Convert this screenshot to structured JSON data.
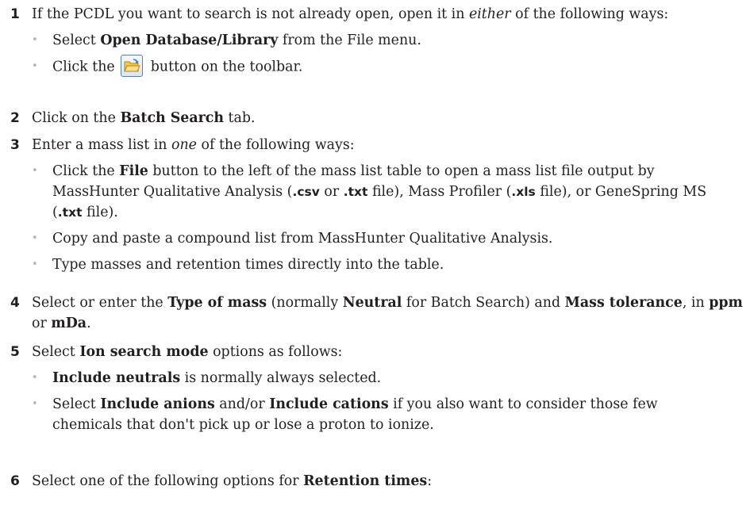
{
  "steps": [
    {
      "number": "1",
      "intro": {
        "t1": "If the PCDL you want to search is not already open, open it in ",
        "em": "either",
        "t2": " of the following ways:"
      },
      "bullets": [
        {
          "t1": "Select ",
          "b1": "Open Database/Library",
          "t2": " from the File menu."
        },
        {
          "t1": "Click the ",
          "icon": "open-folder-icon",
          "t2": " button on the toolbar."
        }
      ]
    },
    {
      "number": "2",
      "intro": {
        "t1": "Click on the ",
        "b1": "Batch Search",
        "t2": " tab."
      }
    },
    {
      "number": "3",
      "intro": {
        "t1": "Enter a mass list in ",
        "em": "one",
        "t2": " of the following ways:"
      },
      "bullets": [
        {
          "t1": "Click the ",
          "b1": "File",
          "t2": " button to the left of the mass list table to open a mass list file output by MassHunter Qualitative Analysis (",
          "s1": ".csv",
          "t3": " or ",
          "s2": ".txt",
          "t4": " file), Mass Profiler (",
          "s3": ".xls",
          "t5": " file), or GeneSpring MS (",
          "s4": ".txt",
          "t6": " file)."
        },
        {
          "t1": "Copy and paste a compound list from MassHunter Qualitative Analysis."
        },
        {
          "t1": "Type masses and retention times directly into the table."
        }
      ]
    },
    {
      "number": "4",
      "intro": {
        "t1": "Select or enter the ",
        "b1": "Type of mass",
        "t2": " (normally ",
        "b2": "Neutral",
        "t3": " for Batch Search) and ",
        "b3": "Mass tolerance",
        "t4": ", in ",
        "b4": "ppm",
        "t5": " or ",
        "b5": "mDa",
        "t6": "."
      }
    },
    {
      "number": "5",
      "intro": {
        "t1": "Select ",
        "b1": "Ion search mode",
        "t2": " options as follows:"
      },
      "bullets": [
        {
          "b1": "Include neutrals",
          "t1": " is normally always selected."
        },
        {
          "t1": "Select ",
          "b1": "Include anions",
          "t2": " and/or ",
          "b2": "Include cations",
          "t3": " if you also want to consider those few chemicals that don't pick up or lose a proton to ionize."
        }
      ]
    },
    {
      "number": "6",
      "intro": {
        "t1": "Select one of the following options for ",
        "b1": "Retention times",
        "t2": ":"
      }
    }
  ]
}
